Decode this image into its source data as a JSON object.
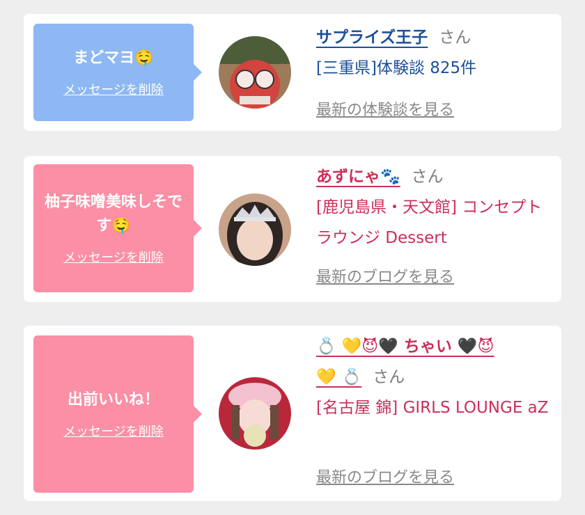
{
  "colors": {
    "bubble_blue": "#8db8f3",
    "bubble_pink": "#fb8fa5",
    "accent_blue": "#1b4f9c",
    "accent_pink": "#cc2e59",
    "muted": "#888888"
  },
  "cards": [
    {
      "message": "まどマヨ🤤",
      "delete_label": "メッセージを削除",
      "name": "サプライズ王子",
      "honorific": "さん",
      "subtitle": "[三重県]体験談 825件",
      "link": "最新の体験談を見る"
    },
    {
      "message": "柚子味噌美味しそです🤤",
      "delete_label": "メッセージを削除",
      "name": "あずにゃ🐾",
      "honorific": "さん",
      "subtitle": "[鹿児島県・天文館] コンセプトラウンジ Dessert",
      "link": "最新のブログを見る"
    },
    {
      "message": "出前いいね！",
      "delete_label": "メッセージを削除",
      "name_line1": "💍 💛😈🖤 ちゃい 🖤😈",
      "name_line2": "💛 💍",
      "honorific": "さん",
      "subtitle": "[名古屋 錦] GIRLS LOUNGE aZ",
      "link": "最新のブログを見る"
    }
  ]
}
